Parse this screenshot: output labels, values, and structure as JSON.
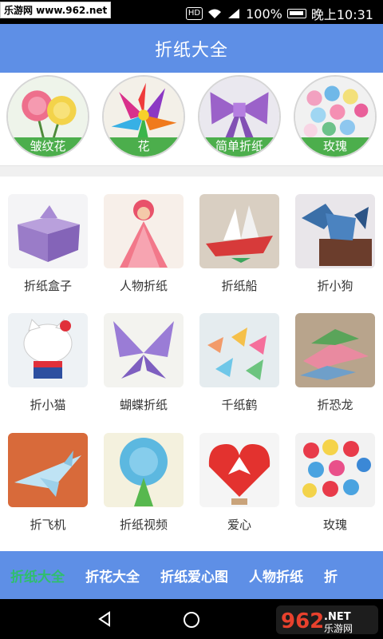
{
  "status_bar": {
    "watermark": "乐游网 www.962.net",
    "network": "HD",
    "battery_percent": "100%",
    "time": "晚上10:31",
    "icons": [
      "wifi-icon",
      "signal-icon",
      "battery-icon"
    ]
  },
  "header": {
    "title": "折纸大全"
  },
  "categories": [
    {
      "label": "皱纹花",
      "icon": "carnation-image"
    },
    {
      "label": "花",
      "icon": "paper-flower-image"
    },
    {
      "label": "简单折纸",
      "icon": "bow-image"
    },
    {
      "label": "玫瑰",
      "icon": "roses-image"
    }
  ],
  "grid": [
    {
      "label": "折纸盒子",
      "icon": "box-image"
    },
    {
      "label": "人物折纸",
      "icon": "doll-image"
    },
    {
      "label": "折纸船",
      "icon": "ship-image"
    },
    {
      "label": "折小狗",
      "icon": "dog-image"
    },
    {
      "label": "折小猫",
      "icon": "kitty-image"
    },
    {
      "label": "蝴蝶折纸",
      "icon": "butterfly-image"
    },
    {
      "label": "千纸鹤",
      "icon": "cranes-image"
    },
    {
      "label": "折恐龙",
      "icon": "dinosaur-image"
    },
    {
      "label": "折飞机",
      "icon": "plane-image"
    },
    {
      "label": "折纸视频",
      "icon": "tree-image"
    },
    {
      "label": "爱心",
      "icon": "heart-image"
    },
    {
      "label": "玫瑰",
      "icon": "rose-bouquet-image"
    }
  ],
  "tabs": [
    {
      "label": "折纸大全",
      "active": true
    },
    {
      "label": "折花大全",
      "active": false
    },
    {
      "label": "折纸爱心图",
      "active": false
    },
    {
      "label": "人物折纸",
      "active": false
    },
    {
      "label": "折",
      "active": false
    }
  ],
  "nav": {
    "buttons": [
      "back-icon",
      "home-icon"
    ],
    "watermark": "962.NET 乐游网"
  },
  "colors": {
    "header": "#5e8fe6",
    "label_bar": "#4cae4c",
    "active_tab": "#2fbf6d"
  }
}
